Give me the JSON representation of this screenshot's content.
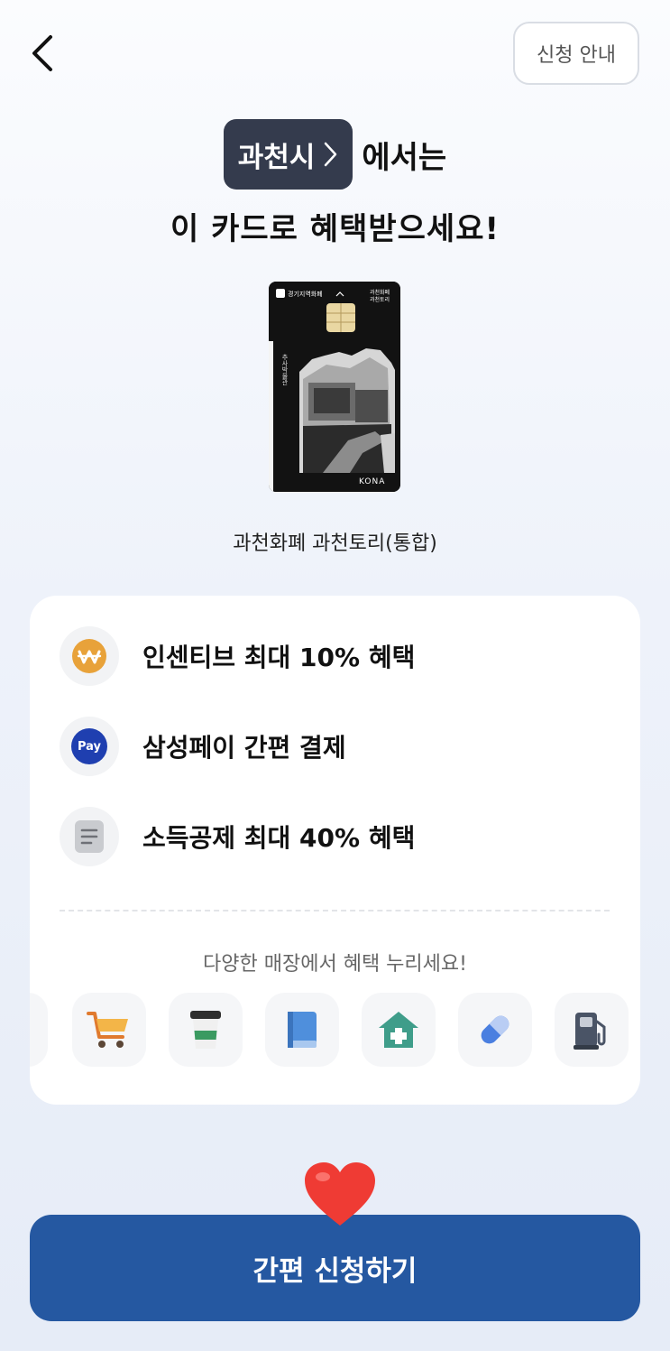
{
  "header": {
    "back_icon": "chevron-left-icon",
    "guide_label": "신청 안내"
  },
  "headline": {
    "city": "과천시",
    "city_chevron": ">",
    "suffix": "에서는",
    "line2": "이 카드로 혜택받으세요!"
  },
  "card": {
    "brand": "경기지역화폐",
    "issuer_line1": "과천화폐",
    "issuer_line2": "과천토리",
    "vertical_text": "추사박물관",
    "maker": "KONA",
    "name": "과천화폐 과천토리(통합)"
  },
  "benefits": [
    {
      "icon": "won-coin-icon",
      "label": "인센티브 최대 10% 혜택"
    },
    {
      "icon": "samsung-pay-icon",
      "icon_text": "Pay",
      "label": "삼성페이 간편 결제"
    },
    {
      "icon": "document-icon",
      "label": "소득공제 최대 40% 혜택"
    }
  ],
  "stores": {
    "caption": "다양한 매장에서 혜택 누리세요!",
    "icons": [
      "cart-icon",
      "coffee-cup-icon",
      "book-icon",
      "hospital-icon",
      "pill-icon",
      "gas-station-icon"
    ]
  },
  "apply": {
    "label": "간편 신청하기",
    "decoration": "heart-icon"
  },
  "colors": {
    "primary": "#2558a1",
    "chip": "#343b4d",
    "coin": "#e8a23a",
    "pay": "#1f3fb0"
  }
}
